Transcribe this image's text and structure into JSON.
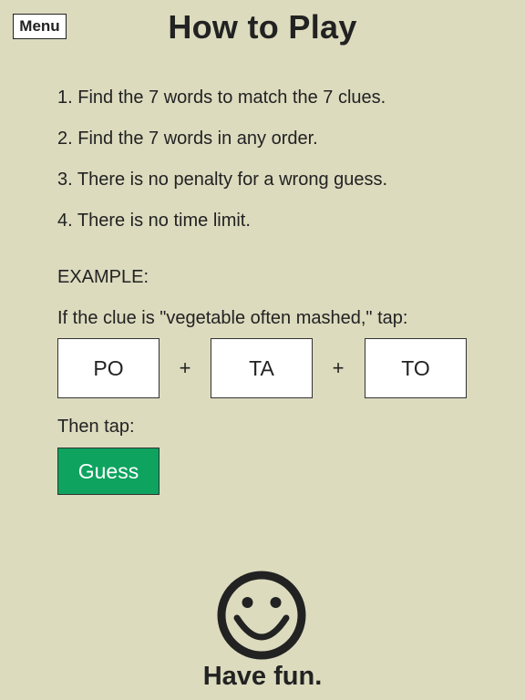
{
  "header": {
    "menu_label": "Menu",
    "title": "How to Play"
  },
  "rules": [
    "1. Find the 7 words to match the 7 clues.",
    "2. Find the 7 words in any order.",
    "3. There is no penalty for a wrong guess.",
    "4. There is no time limit."
  ],
  "example": {
    "heading": "EXAMPLE:",
    "clue_text": "If the clue is \"vegetable often mashed,\" tap:",
    "syllables": [
      "PO",
      "TA",
      "TO"
    ],
    "plus_sign": "+",
    "then_text": "Then tap:",
    "guess_label": "Guess"
  },
  "footer": {
    "smiley_icon": "smiley-face-icon",
    "message": "Have fun."
  },
  "colors": {
    "background": "#dcdbbe",
    "guess_button": "#0ea35f",
    "text": "#222222"
  }
}
